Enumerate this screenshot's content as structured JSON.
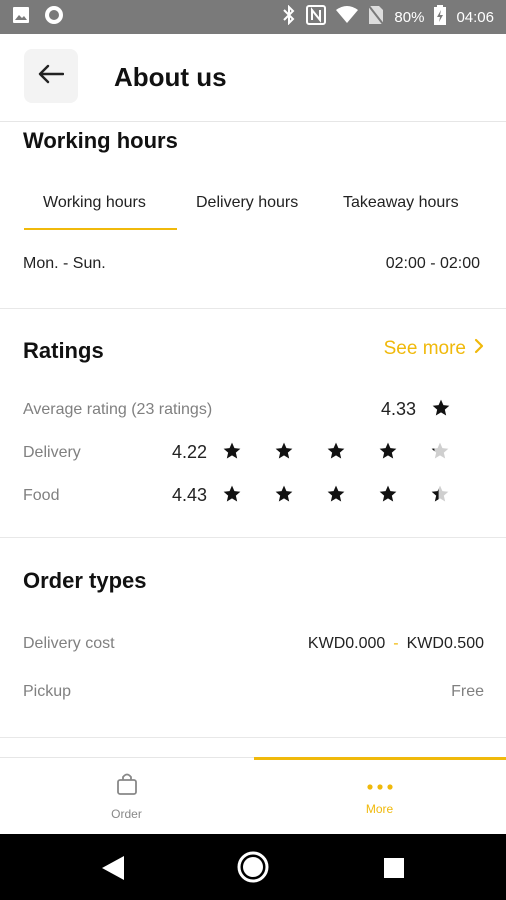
{
  "status_bar": {
    "battery": "80%",
    "time": "04:06",
    "icons": [
      "image-icon",
      "record-icon",
      "bluetooth-icon",
      "nfc-icon",
      "wifi-icon",
      "no-sim-icon",
      "battery-icon"
    ]
  },
  "header": {
    "title": "About us",
    "back_icon": "arrow-left-icon"
  },
  "working_hours": {
    "title": "Working hours",
    "tabs": [
      {
        "label": "Working hours",
        "active": true
      },
      {
        "label": "Delivery hours",
        "active": false
      },
      {
        "label": "Takeaway hours",
        "active": false
      }
    ],
    "days": "Mon. - Sun.",
    "hours": "02:00 - 02:00"
  },
  "ratings": {
    "title": "Ratings",
    "see_more": "See more",
    "average_label": "Average rating (23 ratings)",
    "average_value": "4.33",
    "rows": [
      {
        "label": "Delivery",
        "value": "4.22",
        "stars": 4.22
      },
      {
        "label": "Food",
        "value": "4.43",
        "stars": 4.43
      }
    ]
  },
  "order_types": {
    "title": "Order types",
    "delivery_cost_label": "Delivery cost",
    "delivery_cost_min": "KWD0.000",
    "delivery_cost_sep": "-",
    "delivery_cost_max": "KWD0.500",
    "pickup_label": "Pickup",
    "pickup_value": "Free"
  },
  "bottom_nav": {
    "items": [
      {
        "label": "Order",
        "icon": "shopping-bag-icon",
        "active": false
      },
      {
        "label": "More",
        "icon": "more-dots-icon",
        "active": true
      }
    ]
  },
  "colors": {
    "accent": "#f0b90b",
    "muted": "#808080",
    "status_bar": "#7a7a7a"
  }
}
